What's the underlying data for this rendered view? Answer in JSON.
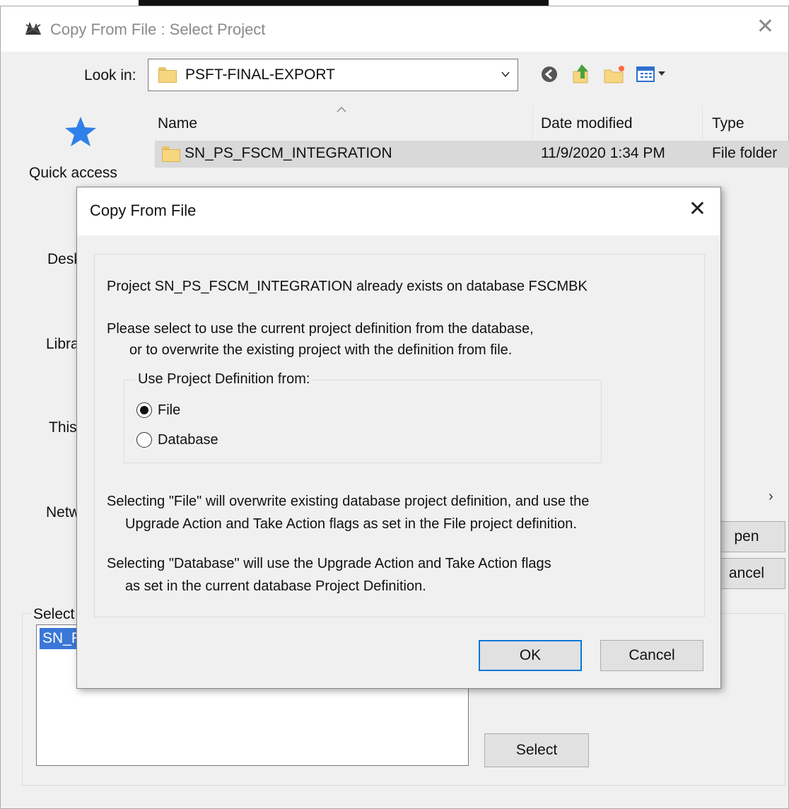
{
  "outer_dialog": {
    "title": "Copy From File : Select Project",
    "look_in_label": "Look in:",
    "look_in_value": "PSFT-FINAL-EXPORT",
    "places": {
      "quick_access": "Quick access",
      "desktop": "Desk",
      "libraries": "Libra",
      "this_pc": "This",
      "network": "Netw"
    },
    "columns": {
      "name": "Name",
      "date_modified": "Date modified",
      "type": "Type"
    },
    "files": [
      {
        "name": "SN_PS_FSCM_INTEGRATION",
        "date_modified": "11/9/2020 1:34 PM",
        "type": "File folder"
      }
    ],
    "open_button": "pen",
    "cancel_button": "ancel",
    "select_group_label": "Select",
    "project_item": "SN_F",
    "select_button": "Select"
  },
  "inner_dialog": {
    "title": "Copy From File",
    "message_exists": "Project SN_PS_FSCM_INTEGRATION already exists on database FSCMBK",
    "message_select_line1": "Please select to use the current project definition from the database,",
    "message_select_line2": "or to overwrite the existing project with the definition from file.",
    "group_label": "Use Project Definition from:",
    "options": [
      {
        "label": "File",
        "selected": true
      },
      {
        "label": "Database",
        "selected": false
      }
    ],
    "note_file_line1": "Selecting \"File\" will overwrite existing database project definition, and use the",
    "note_file_line2": "Upgrade Action and Take Action flags as set in the File project definition.",
    "note_db_line1": "Selecting \"Database\" will use the Upgrade Action and Take Action flags",
    "note_db_line2": "as set in the current database Project Definition.",
    "ok_button": "OK",
    "cancel_button": "Cancel"
  },
  "colors": {
    "dialog_background": "#f0f0f0",
    "selection_blue": "#3b77d8",
    "default_button_border": "#0078d7"
  },
  "icons": {
    "app": "app-icon",
    "back": "back-icon",
    "up_folder": "up-folder-icon",
    "new_folder": "new-folder-icon",
    "view_menu": "view-menu-icon",
    "quick_access": "star-icon"
  }
}
